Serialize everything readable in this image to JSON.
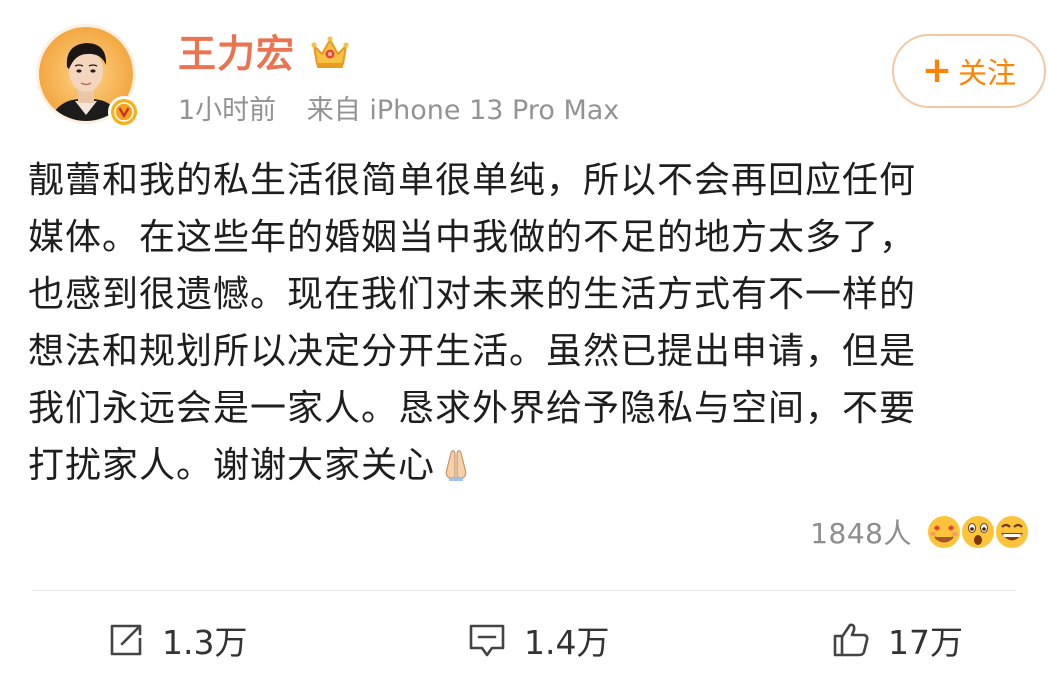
{
  "post": {
    "author": {
      "name": "王力宏",
      "badge_icon": "crown-icon",
      "verified_icon": "verified-v-icon"
    },
    "meta": {
      "time": "1小时前",
      "source": "来自 iPhone 13 Pro Max"
    },
    "follow_label": "关注",
    "content_lines": [
      "靓蕾和我的私生活很简单很单纯，所以不会再回应任何",
      "媒体。在这些年的婚姻当中我做的不足的地方太多了，",
      "也感到很遗憾。现在我们对未来的生活方式有不一样的",
      "想法和规划所以决定分开生活。虽然已提出申请，但是",
      "我们永远会是一家人。恳求外界给予隐私与空间，不要",
      "打扰家人。谢谢大家关心"
    ],
    "reactions": {
      "count_label": "1848人",
      "emojis": [
        "heart-eyes-emoji",
        "surprised-emoji",
        "laughing-emoji"
      ]
    },
    "actions": {
      "repost": "1.3万",
      "comment": "1.4万",
      "like": "17万"
    },
    "colors": {
      "username": "#eb7350",
      "accent": "#ff8200",
      "meta": "#939393"
    }
  }
}
